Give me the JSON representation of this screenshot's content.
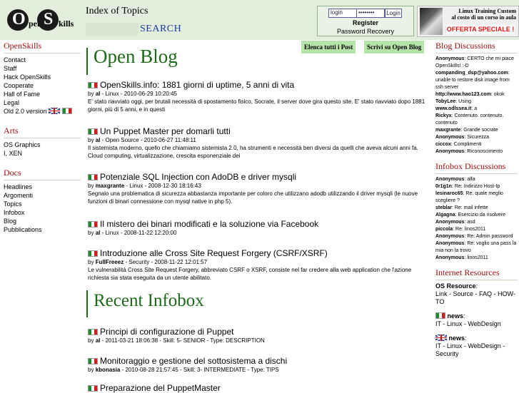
{
  "logo": {
    "o": "O",
    "pen": "pen",
    "s": "S",
    "kills": "kills"
  },
  "header": {
    "index_title": "Index of Topics",
    "search_placeholder": "",
    "search_label": "SEARCH",
    "login_placeholder": "login",
    "password_placeholder": "••••••••",
    "login_button": "Login",
    "register": "Register",
    "password_recovery": "Password Recovery",
    "banner_line1": "Linux Training Custom",
    "banner_line2": "al costo di un corso in aula",
    "banner_offer": "OFFERTA SPECIALE !"
  },
  "left": {
    "openskills_title": "OpenSkills",
    "openskills_items": [
      "Contact",
      "Staff",
      "Hack OpenSkills",
      "Cooperate",
      "Hall of Fame",
      "Legal",
      "Old 2.0 version"
    ],
    "arts_title": "Arts",
    "arts_items": [
      "OS Graphics",
      "I, XEN"
    ],
    "docs_title": "Docs",
    "docs_items": [
      "Headlines",
      "Argomenti",
      "Topics",
      "Infobox",
      "Blog",
      "Pubblications"
    ]
  },
  "main": {
    "title": "Open Blog",
    "btn_all": "Elenca tutti i Post",
    "btn_write": "Scrivi su Open Blog",
    "posts": [
      {
        "title": "OpenSkills.info: 1881 giorni di uptime, 5 anni di vita",
        "by": "by",
        "author": "al",
        "meta": " - Linux - 2010-06-29 10:20:45",
        "body": "E' stato riavviato oggi, per brutali necessità di spostamento fisico, Socrate, il server dove gira questo site. E' stato riavviato dopo 1881 giorni, più di 5 anni, e in questi"
      },
      {
        "title": "Un Puppet Master per domarli tutti",
        "by": "by",
        "author": "al",
        "meta": " - Open Source - 2010-06-27 11:48:11",
        "body": "Il sistemista moderno, quello che chiamiamo sistemista 2.0, ha strumenti e necessità ben diversi da quelli che aveva alcuni anni fa. Cloud computing, virtualizzazione, crescita esponenziale dei"
      },
      {
        "title": "Potenziale SQL Injection con AdoDB e driver mysqli",
        "by": "by",
        "author": "maxgrante",
        "meta": " - Linux - 2008-12-30 18:16:43",
        "body": "Segnalo una problematica di sicurezza abbastanza importante per coloro che utilizzano adodb utilizzando il driver mysqli (le nuove funzioni di binari connessione con mysql native in php 5)."
      },
      {
        "title": "Il mistero dei binari modificati e la soluzione via Facebook",
        "by": "by",
        "author": "al",
        "meta": " - Linux - 2008-11-22 12:20:00",
        "body": ""
      },
      {
        "title": "Introduzione alle Cross Site Request Forgery (CSRF/XSRF)",
        "by": "by",
        "author": "FullFreeez",
        "meta": " - Security - 2008-11-22 12:01:57",
        "body": "Le vulnerabilità Cross Site Request Forgery, abbreviato CSRF o XSRF, consiste nel far credere alla web application che l'azione richiesta sia stata eseguita da un utente abilitato."
      }
    ],
    "recent_title": "Recent Infobox",
    "infobox": [
      {
        "title": "Principi di configurazione di Puppet",
        "by": "by",
        "author": "al",
        "meta": " - 2011-03-21 18:06:38 - Skill: 5- SENIOR - Type: DESCRIPTION"
      },
      {
        "title": "Monitoraggio e gestione del sottosistema a dischi",
        "by": "by",
        "author": "kbonasia",
        "meta": " - 2010-08-28 21:57:45 - Skill: 3- INTERMEDIATE - Type: TIPS"
      },
      {
        "title": "Preparazione del PuppetMaster",
        "by": "",
        "author": "",
        "meta": ""
      }
    ]
  },
  "right": {
    "blog_discussions_title": "Blog Discussions",
    "blog_discussions": [
      {
        "user": "Anonymous",
        "text": ": CERTO che mi piace OpenSkills! :-D"
      },
      {
        "user": "companding_dsp@yahoo.com",
        "text": ": unable to restore disk image from ssh server"
      },
      {
        "user": "http://www.hao123.com",
        "text": ": okok"
      },
      {
        "user": "TobyLee",
        "text": ": Using"
      },
      {
        "user": "www.odlssea.it",
        "text": ": a"
      },
      {
        "user": "Rickyx",
        "text": ": Contenuto. contenuto. contenuto"
      },
      {
        "user": "maxgrante",
        "text": ": Grande socrate"
      },
      {
        "user": "Anonymous",
        "text": ": Sicurezza"
      },
      {
        "user": "ciccox",
        "text": ": Complimenti"
      },
      {
        "user": "Anonymous",
        "text": ": Riconoscimento"
      }
    ],
    "infobox_discussions_title": "Infobox Discussions",
    "infobox_discussions": [
      {
        "user": "Anonymous",
        "text": ": alfa"
      },
      {
        "user": "0r1g1n",
        "text": ": Re: Indirizzo Host-Ip"
      },
      {
        "user": "lesinaroc65",
        "text": ": Re: quale meglio scegliere ?"
      },
      {
        "user": "steblar",
        "text": ": Re: mail infette"
      },
      {
        "user": "Algagna",
        "text": ": Esercizio da risolvere"
      },
      {
        "user": "Anonymous",
        "text": ": asd"
      },
      {
        "user": "piccola",
        "text": ": Re: linos2011"
      },
      {
        "user": "Anonymous",
        "text": ": Re: Admin password"
      },
      {
        "user": "Anonymous",
        "text": ": Re: voglio una pass la mia non la trovo"
      },
      {
        "user": "Anonymous",
        "text": ": linos2011"
      }
    ],
    "internet_resources_title": "Internet Resources",
    "os_resource_label": "OS Resource",
    "os_resource_links": "Link - Source - FAQ - HOW-TO",
    "news_label": "news",
    "news_it": "IT - Linux - WebDesign",
    "news_en": "IT - Linux - WebDesign - Security"
  }
}
